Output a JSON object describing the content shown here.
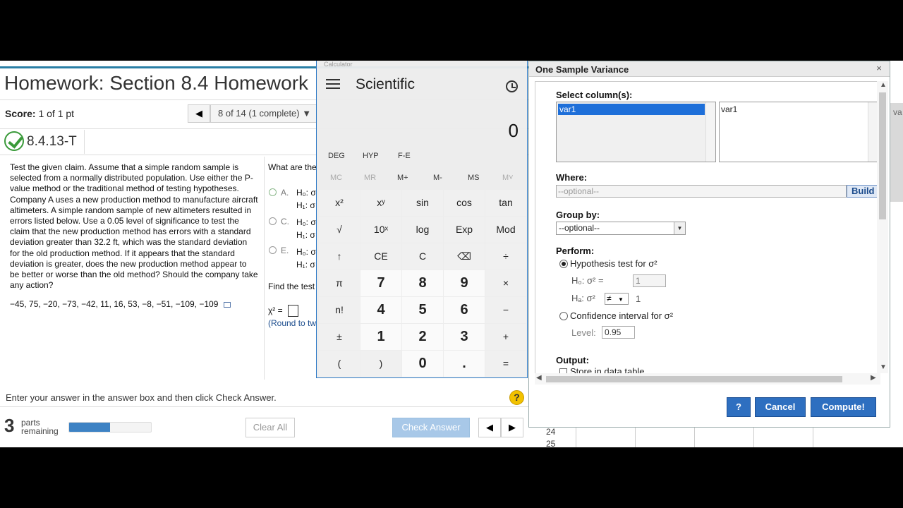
{
  "homework": {
    "title": "Homework: Section 8.4 Homework",
    "score_label": "Score:",
    "score_value": "1 of 1 pt",
    "nav_prev": "◀",
    "nav_position": "8 of 14 (1 complete) ▼",
    "question_id": "8.4.13-T",
    "problem_text": "Test the given claim. Assume that a simple random sample is selected from a normally distributed population. Use either the P-value method or the traditional method of testing hypotheses. Company A uses a new production method to manufacture aircraft altimeters. A simple random sample of new altimeters resulted in errors listed below. Use a 0.05 level of significance to test the claim that the new production method has errors with a standard deviation greater than 32.2 ft, which was the standard deviation for the old production method. If it appears that the standard deviation is greater, does the new production method appear to be better or worse than the old method? Should the company take any action?",
    "data_values": "−45, 75, −20, −73, −42, 11, 16, 53, −8, −51, −109, −109",
    "right_prompt": "What are the",
    "option_a": "A.",
    "option_c": "C.",
    "option_e": "E.",
    "h0": "H₀: σ",
    "h1": "H₁: σ",
    "find_test": "Find the test",
    "chi_label": "χ² =",
    "round_note": "(Round to tw",
    "instructions": "Enter your answer in the answer box and then click Check Answer.",
    "help": "?",
    "parts_count": "3",
    "parts_label": "parts remaining",
    "progress_fraction": 0.5,
    "clear_all": "Clear All",
    "check_answer": "Check Answer",
    "prev_arrow": "◀",
    "next_arrow": "▶"
  },
  "calculator": {
    "titlebar": "Calculator",
    "mode": "Scientific",
    "display": "0",
    "angle_modes": [
      "DEG",
      "HYP",
      "F-E"
    ],
    "memory": [
      "MC",
      "MR",
      "M+",
      "M-",
      "MS",
      "M˅"
    ],
    "keys": [
      [
        "x²",
        "xʸ",
        "sin",
        "cos",
        "tan"
      ],
      [
        "√",
        "10ˣ",
        "log",
        "Exp",
        "Mod"
      ],
      [
        "↑",
        "CE",
        "C",
        "⌫",
        "÷"
      ],
      [
        "π",
        "7",
        "8",
        "9",
        "×"
      ],
      [
        "n!",
        "4",
        "5",
        "6",
        "−"
      ],
      [
        "±",
        "1",
        "2",
        "3",
        "+"
      ],
      [
        "(",
        ")",
        "0",
        ".",
        "="
      ]
    ]
  },
  "dialog": {
    "title": "One Sample Variance",
    "close": "×",
    "select_columns_label": "Select column(s):",
    "left_list": [
      "var1"
    ],
    "right_list": [
      "var1"
    ],
    "where_label": "Where:",
    "where_placeholder": "--optional--",
    "build_button": "Build",
    "group_by_label": "Group by:",
    "group_by_value": "--optional--",
    "perform_label": "Perform:",
    "hypothesis_option": "Hypothesis test for σ²",
    "h0_label": "H₀: σ²  =",
    "h0_value": "1",
    "ha_label": "Hₐ: σ²",
    "ha_operator": "≠",
    "ha_value": "1",
    "ci_option": "Confidence interval for σ²",
    "level_label": "Level:",
    "level_value": "0.95",
    "output_label": "Output:",
    "store_label": "Store in data table",
    "help_button": "?",
    "cancel_button": "Cancel",
    "compute_button": "Compute!"
  },
  "sheet": {
    "rows": [
      "24",
      "25"
    ],
    "col_label": "va"
  }
}
